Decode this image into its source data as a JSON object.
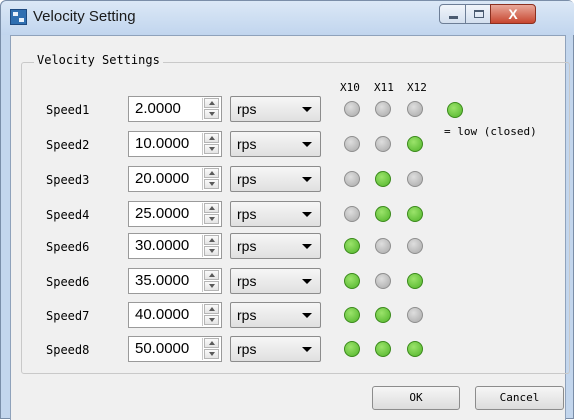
{
  "window": {
    "title": "Velocity Setting",
    "close_glyph": "X"
  },
  "group": {
    "title": "Velocity Settings"
  },
  "columns": [
    "X10",
    "X11",
    "X12"
  ],
  "legend": {
    "text": "= low (closed)",
    "color": "#51b42a"
  },
  "colors": {
    "led_on": "#51b42a",
    "led_off": "#a9a9a9"
  },
  "rows": [
    {
      "label": "Speed1",
      "value": "2.0000",
      "unit": "rps",
      "leds": [
        false,
        false,
        false
      ]
    },
    {
      "label": "Speed2",
      "value": "10.0000",
      "unit": "rps",
      "leds": [
        false,
        false,
        true
      ]
    },
    {
      "label": "Speed3",
      "value": "20.0000",
      "unit": "rps",
      "leds": [
        false,
        true,
        false
      ]
    },
    {
      "label": "Speed4",
      "value": "25.0000",
      "unit": "rps",
      "leds": [
        false,
        true,
        true
      ]
    },
    {
      "label": "Speed6",
      "value": "30.0000",
      "unit": "rps",
      "leds": [
        true,
        false,
        false
      ]
    },
    {
      "label": "Speed6",
      "value": "35.0000",
      "unit": "rps",
      "leds": [
        true,
        false,
        true
      ]
    },
    {
      "label": "Speed7",
      "value": "40.0000",
      "unit": "rps",
      "leds": [
        true,
        true,
        false
      ]
    },
    {
      "label": "Speed8",
      "value": "50.0000",
      "unit": "rps",
      "leds": [
        true,
        true,
        true
      ]
    }
  ],
  "buttons": {
    "ok": "OK",
    "cancel": "Cancel"
  }
}
